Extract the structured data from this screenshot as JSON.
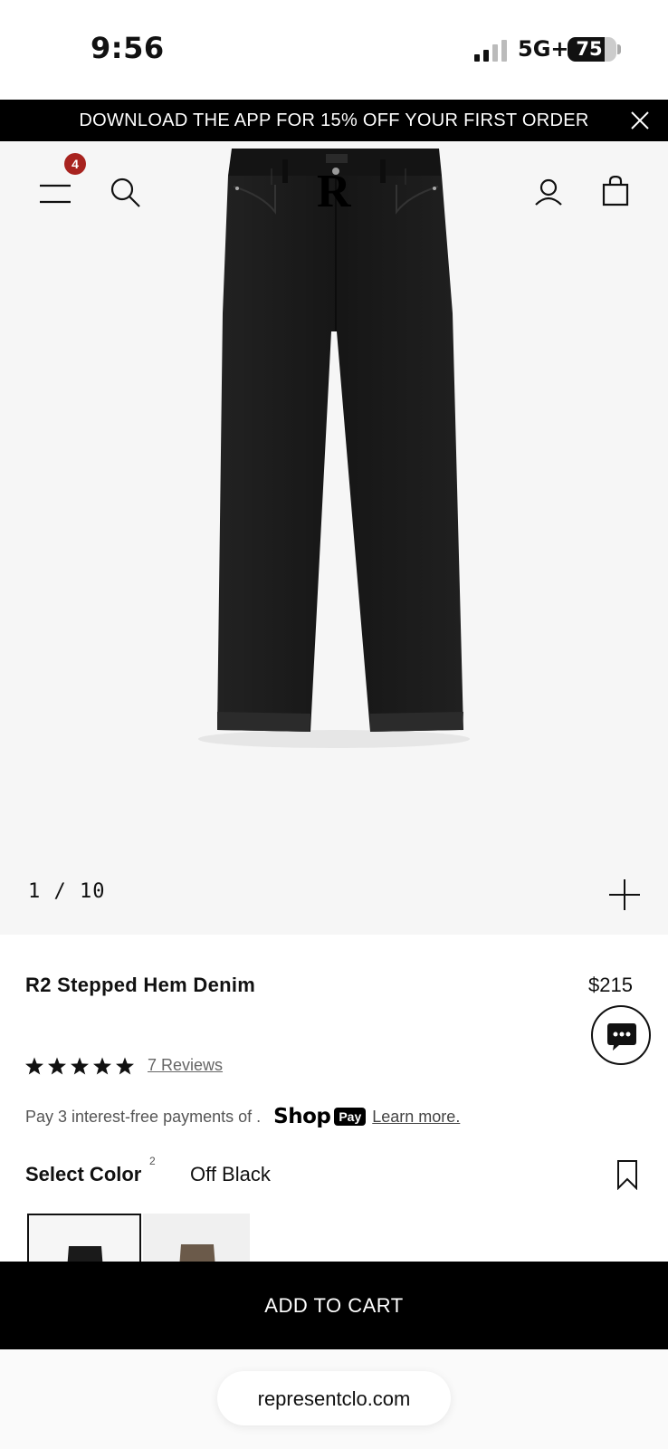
{
  "status_bar": {
    "time": "9:56",
    "network": "5G+",
    "battery_level": "75",
    "battery_fraction": 0.75
  },
  "promo_banner": {
    "text": "DOWNLOAD THE APP FOR 15% OFF YOUR FIRST ORDER"
  },
  "header": {
    "menu_badge_count": "4",
    "icons": [
      "menu-icon",
      "search-icon",
      "account-icon",
      "bag-icon"
    ]
  },
  "gallery": {
    "current": "1",
    "total": "10",
    "counter_text": "1 / 10",
    "brand_mark": "R"
  },
  "product": {
    "title": "R2 Stepped Hem Denim",
    "price": "$215",
    "rating": 5,
    "rating_max": 5,
    "reviews_label": "7 Reviews",
    "installments_text": "Pay 3 interest-free payments of .",
    "shop_logo": "Shop",
    "shop_pay_badge": "Pay",
    "learn_more": "Learn more.",
    "select_color_label": "Select Color",
    "color_count": "2",
    "selected_color": "Off Black",
    "swatches": [
      {
        "name": "Off Black",
        "color": "#1a1a1a"
      },
      {
        "name": "Brown",
        "color": "#6b5a4a"
      }
    ]
  },
  "cta": {
    "add_to_cart": "ADD TO CART"
  },
  "browser": {
    "url": "representclo.com"
  },
  "colors": {
    "banner_bg": "#000000",
    "badge_red": "#a8231f",
    "hero_bg": "#f6f6f6"
  }
}
